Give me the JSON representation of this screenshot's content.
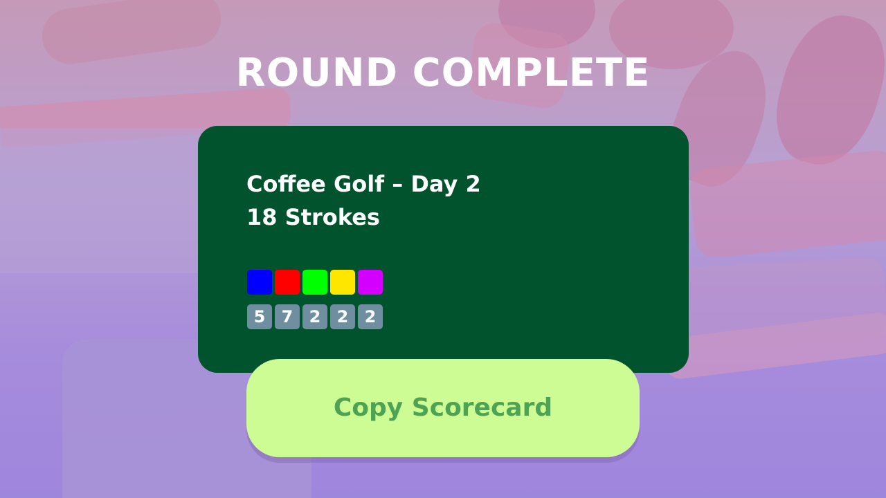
{
  "screen": {
    "title": "ROUND COMPLETE"
  },
  "scorecard": {
    "game_line": "Coffee Golf – Day 2",
    "strokes_line": "18 Strokes",
    "holes": [
      {
        "color": "#0000ff",
        "score": "5"
      },
      {
        "color": "#ff0000",
        "score": "7"
      },
      {
        "color": "#00ff00",
        "score": "2"
      },
      {
        "color": "#ffe600",
        "score": "2"
      },
      {
        "color": "#d400ff",
        "score": "2"
      }
    ]
  },
  "actions": {
    "copy_label": "Copy Scorecard"
  },
  "colors": {
    "card_bg": "#01532d",
    "button_bg": "#cefc94",
    "button_text": "#4ea352",
    "score_tile": "#6f8fa0"
  }
}
